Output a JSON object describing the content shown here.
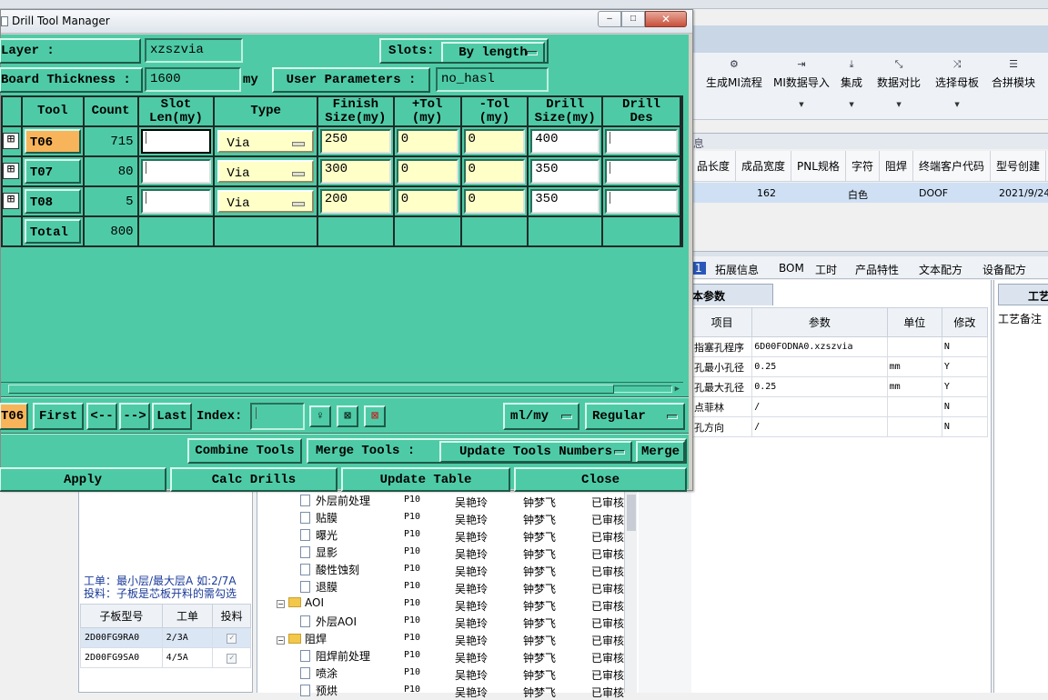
{
  "window": {
    "title": "Drill Tool Manager",
    "minimize": "‒",
    "maximize": "□",
    "close": "✕"
  },
  "header": {
    "layer_label": "Layer             :",
    "layer_value": "xzszvia",
    "slots_label": "Slots:",
    "slots_value": "By length",
    "board_thickness_label": "Board Thickness :",
    "board_thickness_value": "1600",
    "board_thickness_unit": "my",
    "user_params_label": "User Parameters :",
    "user_params_value": "no_hasl"
  },
  "grid": {
    "columns": {
      "tool": "Tool",
      "count": "Count",
      "slot_len": [
        "Slot",
        "Len(my)"
      ],
      "type": "Type",
      "finish_size": [
        "Finish",
        "Size(my)"
      ],
      "plus_tol": [
        "+Tol",
        "(my)"
      ],
      "minus_tol": [
        "-Tol",
        "(my)"
      ],
      "drill_size": [
        "Drill",
        "Size(my)"
      ],
      "drill_des": [
        "Drill",
        "Des"
      ]
    },
    "rows": [
      {
        "tool": "T06",
        "count": "715",
        "slot_len": "",
        "type": "Via",
        "finish_size": "250",
        "plus_tol": "0",
        "minus_tol": "0",
        "drill_size": "400",
        "drill_des": ""
      },
      {
        "tool": "T07",
        "count": "80",
        "slot_len": "",
        "type": "Via",
        "finish_size": "300",
        "plus_tol": "0",
        "minus_tol": "0",
        "drill_size": "350",
        "drill_des": ""
      },
      {
        "tool": "T08",
        "count": "5",
        "slot_len": "",
        "type": "Via",
        "finish_size": "200",
        "plus_tol": "0",
        "minus_tol": "0",
        "drill_size": "350",
        "drill_des": ""
      }
    ],
    "total_label": "Total",
    "total_count": "800"
  },
  "navigation": {
    "current_tool": "T06",
    "first": "First",
    "prev": "<--",
    "next": "-->",
    "last": "Last",
    "index_label": "Index:",
    "index_value": "",
    "units_value": "ml/my",
    "mode_value": "Regular"
  },
  "tools_bar": {
    "combine": "Combine Tools",
    "merge_label": "Merge Tools :",
    "update_numbers": "Update Tools Numbers",
    "merge": "Merge"
  },
  "actions": {
    "apply": "Apply",
    "calc": "Calc Drills",
    "update_table": "Update Table",
    "close": "Close"
  },
  "background": {
    "ribbon": [
      {
        "icon": "gears-icon",
        "label": "生成MI流程"
      },
      {
        "icon": "import-icon",
        "label": "MI数据导入"
      },
      {
        "icon": "download-icon",
        "label": "集成"
      },
      {
        "icon": "compare-icon",
        "label": "数据对比"
      },
      {
        "icon": "shuffle-icon",
        "label": "选择母板"
      },
      {
        "icon": "list-icon",
        "label": "合拼模块"
      }
    ],
    "info_tab": "息",
    "table1_headers": [
      "品长度",
      "成品宽度",
      "PNL规格",
      "字符",
      "阻焊",
      "终端客户代码",
      "型号创建"
    ],
    "table1_row": [
      "162",
      "白色",
      "DOOF",
      "2021/9/24"
    ],
    "tabs2": [
      "1",
      "拓展信息",
      "BOM",
      "工时",
      "产品特性",
      "文本配方",
      "设备配方"
    ],
    "param_title": "本参数",
    "param_headers": [
      "项目",
      "参数",
      "单位",
      "修改"
    ],
    "param_rows": [
      [
        "指塞孔程序",
        "6D00FODNA0.xzszvia",
        "",
        "N"
      ],
      [
        "孔最小孔径",
        "0.25",
        "mm",
        "Y"
      ],
      [
        "孔最大孔径",
        "0.25",
        "mm",
        "Y"
      ],
      [
        "点菲林",
        "/",
        "",
        "N"
      ],
      [
        "孔方向",
        "/",
        "",
        "N"
      ]
    ],
    "right_tab": "工艺",
    "right_header": "工艺备注",
    "left_note_1": "工单：最小层/最大层A 如:2/7A",
    "left_note_2": "投料：子板是芯板开料的需勾选",
    "sub_headers": [
      "子板型号",
      "工单",
      "投料"
    ],
    "sub_rows": [
      [
        "2D00FG9RA0",
        "2/3A"
      ],
      [
        "2D00FG9SA0",
        "4/5A"
      ]
    ],
    "tree": [
      {
        "name": "外层前处理",
        "code": "P10",
        "p1": "吴艳玲",
        "p2": "钟梦飞",
        "status": "已审核",
        "kind": "doc"
      },
      {
        "name": "贴膜",
        "code": "P10",
        "p1": "吴艳玲",
        "p2": "钟梦飞",
        "status": "已审核",
        "kind": "doc"
      },
      {
        "name": "曝光",
        "code": "P10",
        "p1": "吴艳玲",
        "p2": "钟梦飞",
        "status": "已审核",
        "kind": "doc"
      },
      {
        "name": "显影",
        "code": "P10",
        "p1": "吴艳玲",
        "p2": "钟梦飞",
        "status": "已审核",
        "kind": "doc"
      },
      {
        "name": "酸性蚀刻",
        "code": "P10",
        "p1": "吴艳玲",
        "p2": "钟梦飞",
        "status": "已审核",
        "kind": "doc"
      },
      {
        "name": "退膜",
        "code": "P10",
        "p1": "吴艳玲",
        "p2": "钟梦飞",
        "status": "已审核",
        "kind": "doc"
      },
      {
        "name": "AOI",
        "code": "P10",
        "p1": "吴艳玲",
        "p2": "钟梦飞",
        "status": "已审核",
        "kind": "folder"
      },
      {
        "name": "外层AOI",
        "code": "P10",
        "p1": "吴艳玲",
        "p2": "钟梦飞",
        "status": "已审核",
        "kind": "doc"
      },
      {
        "name": "阻焊",
        "code": "P10",
        "p1": "吴艳玲",
        "p2": "钟梦飞",
        "status": "已审核",
        "kind": "folder"
      },
      {
        "name": "阻焊前处理",
        "code": "P10",
        "p1": "吴艳玲",
        "p2": "钟梦飞",
        "status": "已审核",
        "kind": "doc"
      },
      {
        "name": "喷涂",
        "code": "P10",
        "p1": "吴艳玲",
        "p2": "钟梦飞",
        "status": "已审核",
        "kind": "doc"
      },
      {
        "name": "预烘",
        "code": "P10",
        "p1": "吴艳玲",
        "p2": "钟梦飞",
        "status": "已审核",
        "kind": "doc"
      }
    ]
  }
}
